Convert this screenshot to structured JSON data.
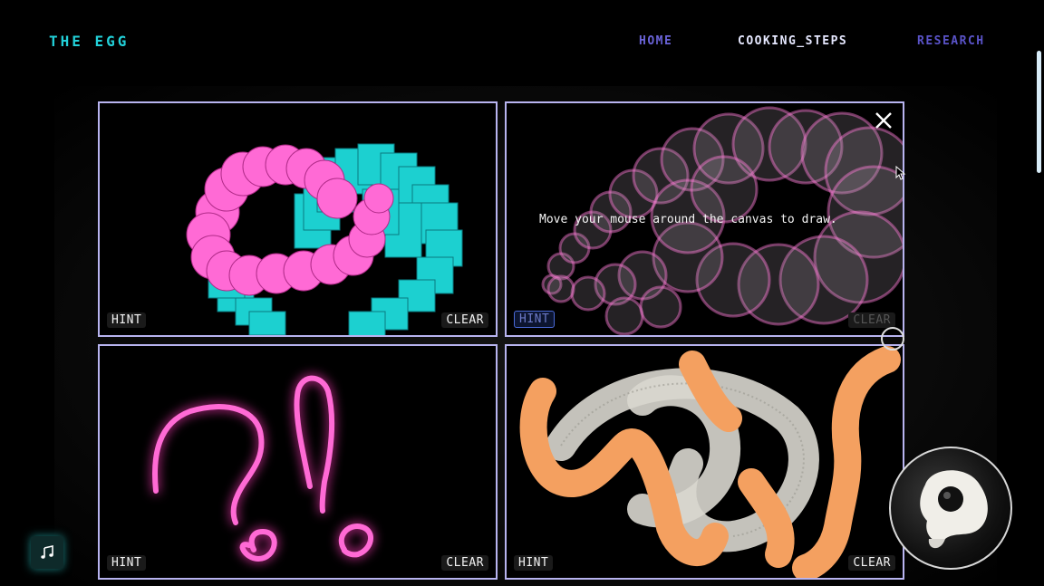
{
  "header": {
    "brand": "THE EGG",
    "nav": [
      {
        "label": "HOME"
      },
      {
        "label": "COOKING_STEPS"
      },
      {
        "label": "RESEARCH"
      }
    ]
  },
  "panels": [
    {
      "hint_label": "HINT",
      "clear_label": "CLEAR"
    },
    {
      "hint_label": "HINT",
      "clear_label": "CLEAR",
      "message": "Move your mouse around the canvas to draw."
    },
    {
      "hint_label": "HINT",
      "clear_label": "CLEAR"
    },
    {
      "hint_label": "HINT",
      "clear_label": "CLEAR"
    }
  ],
  "colors": {
    "accent_cyan": "#22d0d8",
    "nav_purple": "#6a63d8",
    "panel_border": "#b8b4f0",
    "pink": "#ff6ad5",
    "orange": "#f4a060"
  },
  "icons": {
    "close": "close-icon",
    "music": "music-note-icon",
    "cursor": "mouse-cursor-icon",
    "egg": "egg-icon"
  }
}
